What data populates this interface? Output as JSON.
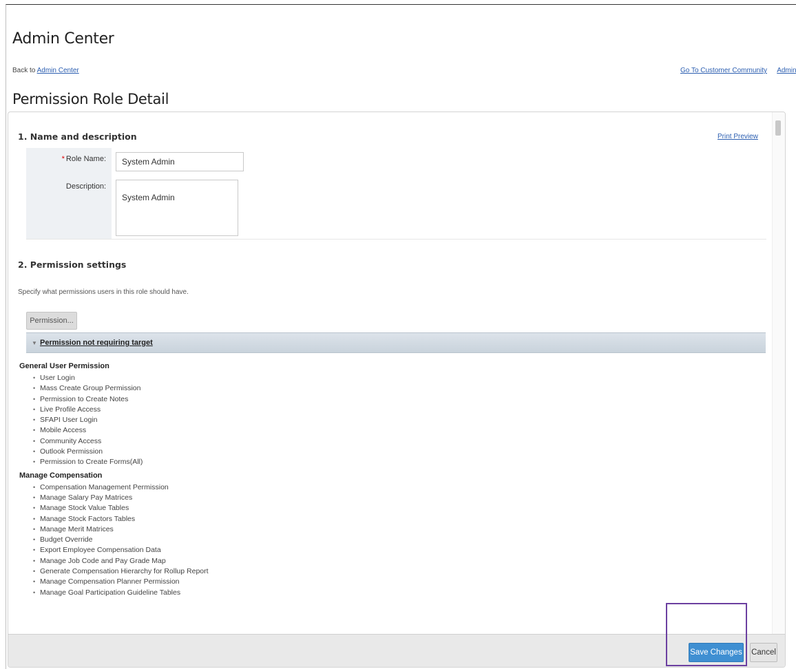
{
  "header": {
    "app_title": "Admin Center",
    "back_prefix": "Back to",
    "back_link": "Admin Center",
    "links": [
      "Go To Customer Community",
      "Admin Re"
    ],
    "page_title": "Permission Role Detail"
  },
  "section1": {
    "title": "1. Name and description",
    "print_preview": "Print Preview",
    "role_name_label": "Role Name:",
    "role_name_value": "System Admin",
    "description_label": "Description:",
    "description_value": "System Admin"
  },
  "section2": {
    "title": "2. Permission settings",
    "help": "Specify what permissions users in this role should have.",
    "permission_button": "Permission...",
    "group_header": "Permission not requiring target",
    "categories": [
      {
        "name": "General User Permission",
        "items": [
          "User Login",
          "Mass Create Group Permission",
          "Permission to Create Notes",
          "Live Profile Access",
          "SFAPI User Login",
          "Mobile Access",
          "Community Access",
          "Outlook Permission",
          "Permission to Create Forms(All)"
        ]
      },
      {
        "name": "Manage Compensation",
        "items": [
          "Compensation Management Permission",
          "Manage Salary Pay Matrices",
          "Manage Stock Value Tables",
          "Manage Stock Factors Tables",
          "Manage Merit Matrices",
          "Budget Override",
          "Export Employee Compensation Data",
          "Manage Job Code and Pay Grade Map",
          "Generate Compensation Hierarchy for Rollup Report",
          "Manage Compensation Planner Permission",
          "Manage Goal Participation Guideline Tables"
        ]
      }
    ]
  },
  "footer": {
    "save_label": "Save Changes",
    "cancel_label": "Cancel"
  },
  "colors": {
    "accent": "#3f8fd2",
    "highlight": "#6b3fa0",
    "link": "#2a5db0"
  }
}
